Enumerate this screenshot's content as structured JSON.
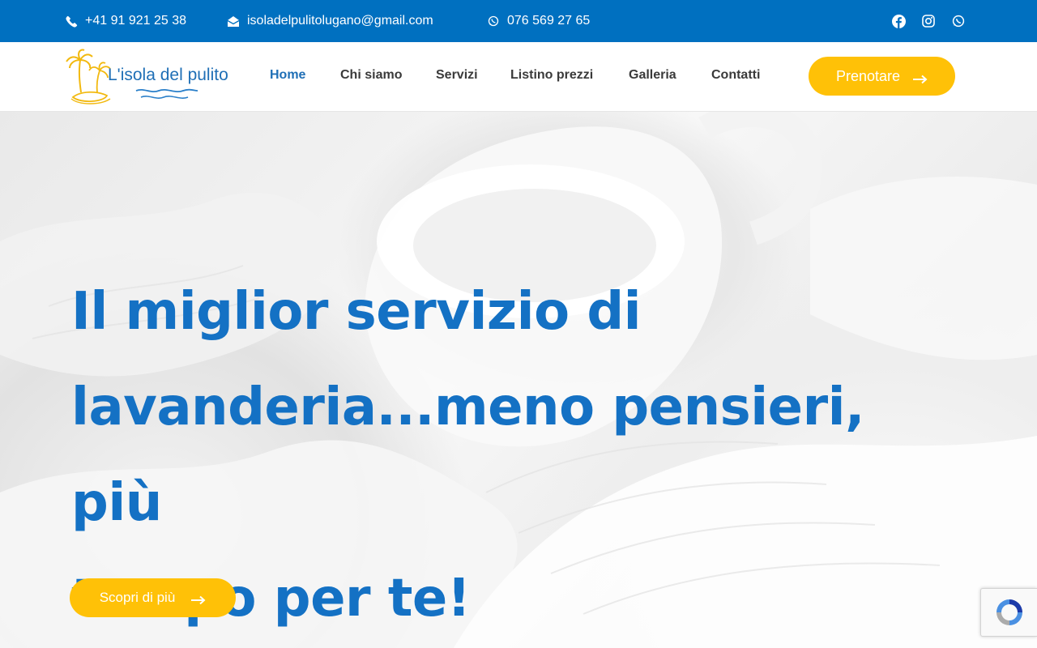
{
  "topbar": {
    "phone": "+41 91 921 25 38",
    "email": "isoladelpulitolugano@gmail.com",
    "whatsapp": "076 569 27 65",
    "social": [
      "facebook-icon",
      "instagram-icon",
      "whatsapp-icon"
    ]
  },
  "header": {
    "logo_text": "L'isola del pulito",
    "nav": [
      "Home",
      "Chi siamo",
      "Servizi",
      "Listino prezzi",
      "Galleria",
      "Contatti"
    ],
    "active_nav": "Home",
    "cta_label": "Prenotare"
  },
  "hero": {
    "title_line1": "Il miglior servizio di",
    "title_line2": "lavanderia...meno pensieri, più",
    "title_line3": "tempo per te!",
    "button_label": "Scopri di più"
  },
  "colors": {
    "brand_blue": "#0070c0",
    "heading_blue": "#1471c4",
    "accent_yellow": "#ffc107"
  }
}
